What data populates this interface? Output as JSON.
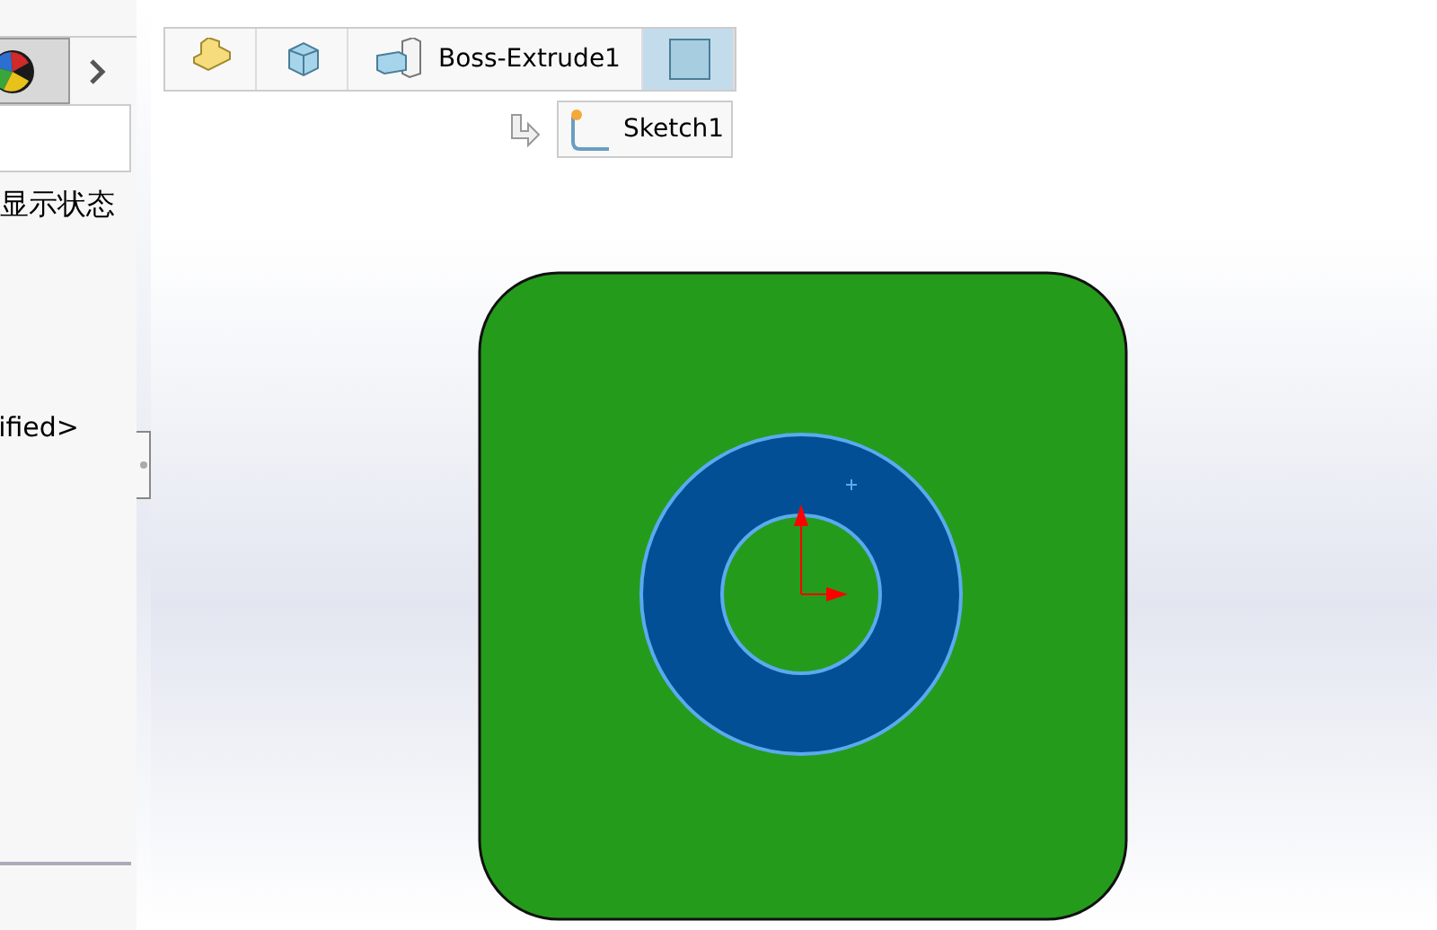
{
  "left_panel": {
    "texts": [
      "显示状态",
      "ified>"
    ]
  },
  "breadcrumb": {
    "items": [
      {
        "kind": "part",
        "selected": false
      },
      {
        "kind": "body",
        "selected": false
      },
      {
        "kind": "feature",
        "label": "Boss-Extrude1",
        "selected": false
      },
      {
        "kind": "face",
        "selected": true
      }
    ],
    "child": {
      "label": "Sketch1"
    }
  }
}
